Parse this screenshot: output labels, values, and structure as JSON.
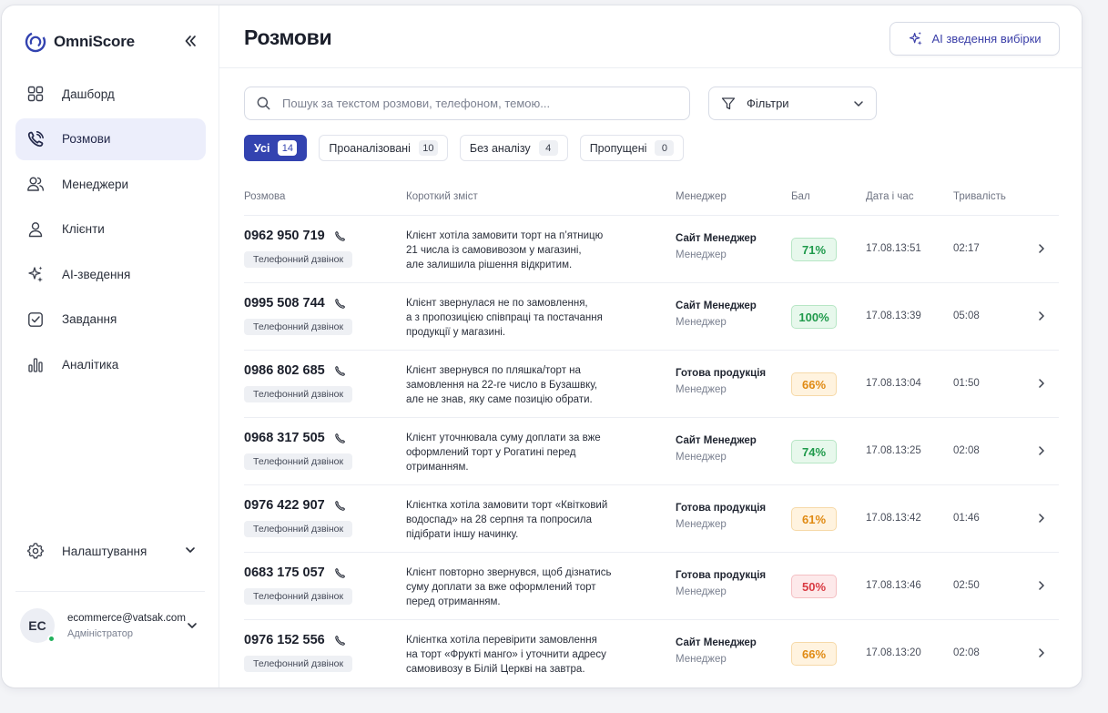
{
  "brand": {
    "name": "OmniScore",
    "accent": "#3343b0"
  },
  "nav": [
    {
      "label": "Дашборд",
      "icon": "dashboard-icon",
      "active": false
    },
    {
      "label": "Розмови",
      "icon": "phone-call-icon",
      "active": true
    },
    {
      "label": "Менеджери",
      "icon": "users-icon",
      "active": false
    },
    {
      "label": "Клієнти",
      "icon": "user-icon",
      "active": false
    },
    {
      "label": "AI-зведення",
      "icon": "sparkles-icon",
      "active": false
    },
    {
      "label": "Завдання",
      "icon": "checkbox-icon",
      "active": false
    },
    {
      "label": "Аналітика",
      "icon": "bar-chart-icon",
      "active": false
    }
  ],
  "settings": {
    "label": "Налаштування"
  },
  "user": {
    "initials": "EC",
    "email": "ecommerce@vatsak.com",
    "role": "Адміністратор"
  },
  "header": {
    "title": "Розмови",
    "ai_button_label": "AI зведення вибірки"
  },
  "search": {
    "placeholder": "Пошук за текстом розмови, телефоном, темою...",
    "value": ""
  },
  "filters": {
    "label": "Фільтри"
  },
  "tabs": [
    {
      "label": "Усі",
      "count": "14",
      "active": true
    },
    {
      "label": "Проаналізовані",
      "count": "10",
      "active": false
    },
    {
      "label": "Без аналізу",
      "count": "4",
      "active": false
    },
    {
      "label": "Пропущені",
      "count": "0",
      "active": false
    }
  ],
  "table": {
    "columns": {
      "call": "Розмова",
      "summary": "Короткий зміст",
      "manager": "Менеджер",
      "score": "Бал",
      "datetime": "Дата і час",
      "duration": "Тривалість"
    },
    "rows": [
      {
        "phone": "0962 950 719",
        "type": "Телефонний дзвінок",
        "summary": [
          "Клієнт хотіла замовити торт на п’ятницю",
          "21 числа із самовивозом у магазині,",
          "але залишила рішення відкритим."
        ],
        "manager": "Сайт Менеджер",
        "role": "Менеджер",
        "score": "71%",
        "score_level": "green",
        "datetime": "17.08.13:51",
        "duration": "02:17"
      },
      {
        "phone": "0995 508 744",
        "type": "Телефонний дзвінок",
        "summary": [
          "Клієнт звернулася не по замовлення,",
          "а з пропозицією співпраці та постачання",
          "продукції у магазині."
        ],
        "manager": "Сайт Менеджер",
        "role": "Менеджер",
        "score": "100%",
        "score_level": "green",
        "datetime": "17.08.13:39",
        "duration": "05:08"
      },
      {
        "phone": "0986 802 685",
        "type": "Телефонний дзвінок",
        "summary": [
          "Клієнт звернувся по пляшка/торт на",
          "замовлення на 22-ге число в Бузашвку,",
          "але не знав, яку саме позицію обрати."
        ],
        "manager": "Готова продукція",
        "role": "Менеджер",
        "score": "66%",
        "score_level": "amber",
        "datetime": "17.08.13:04",
        "duration": "01:50"
      },
      {
        "phone": "0968 317 505",
        "type": "Телефонний дзвінок",
        "summary": [
          "Клієнт уточнювала суму доплати за вже",
          "оформлений торт у Рогатині перед",
          "отриманням."
        ],
        "manager": "Сайт Менеджер",
        "role": "Менеджер",
        "score": "74%",
        "score_level": "green",
        "datetime": "17.08.13:25",
        "duration": "02:08"
      },
      {
        "phone": "0976 422 907",
        "type": "Телефонний дзвінок",
        "summary": [
          "Клієнтка хотіла замовити торт «Квітковий",
          "водоспад» на 28 серпня та попросила",
          "підібрати іншу начинку."
        ],
        "manager": "Готова продукція",
        "role": "Менеджер",
        "score": "61%",
        "score_level": "amber",
        "datetime": "17.08.13:42",
        "duration": "01:46"
      },
      {
        "phone": "0683 175 057",
        "type": "Телефонний дзвінок",
        "summary": [
          "Клієнт повторно звернувся, щоб дізнатись",
          "суму доплати за вже оформлений торт",
          "перед отриманням."
        ],
        "manager": "Готова продукція",
        "role": "Менеджер",
        "score": "50%",
        "score_level": "red",
        "datetime": "17.08.13:46",
        "duration": "02:50"
      },
      {
        "phone": "0976 152 556",
        "type": "Телефонний дзвінок",
        "summary": [
          "Клієнтка хотіла перевірити замовлення",
          "на торт «Фрукті манго» і уточнити адресу",
          "самовивозу в Білій Церкві на завтра."
        ],
        "manager": "Сайт Менеджер",
        "role": "Менеджер",
        "score": "66%",
        "score_level": "amber",
        "datetime": "17.08.13:20",
        "duration": "02:08"
      }
    ]
  }
}
